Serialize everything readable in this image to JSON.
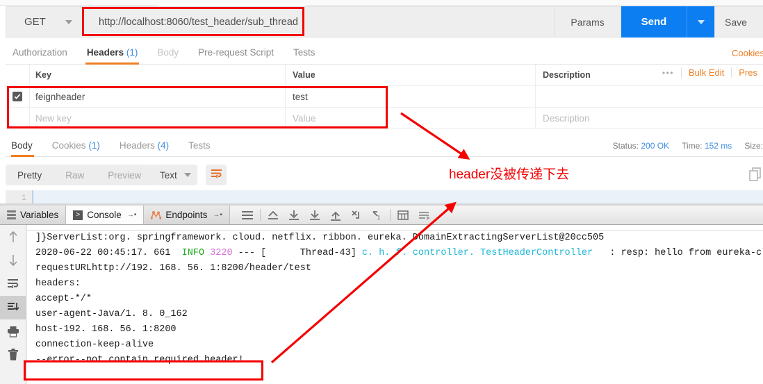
{
  "request": {
    "method": "GET",
    "url": "http://localhost:8060/test_header/sub_thread",
    "params_label": "Params",
    "send_label": "Send",
    "save_label": "Save"
  },
  "request_tabs": [
    {
      "label": "Authorization",
      "count": "",
      "state": "normal"
    },
    {
      "label": "Headers",
      "count": "(1)",
      "state": "active"
    },
    {
      "label": "Body",
      "count": "",
      "state": "dim"
    },
    {
      "label": "Pre-request Script",
      "count": "",
      "state": "normal"
    },
    {
      "label": "Tests",
      "count": "",
      "state": "normal"
    }
  ],
  "cookies_link": "Cookies",
  "headers_table": {
    "columns": [
      "Key",
      "Value",
      "Description"
    ],
    "rows": [
      {
        "checked": true,
        "key": "feignheader",
        "value": "test",
        "description": ""
      }
    ],
    "new_row": {
      "key_placeholder": "New key",
      "value_placeholder": "Value",
      "desc_placeholder": "Description"
    },
    "actions": {
      "dots": "•••",
      "bulk_edit": "Bulk Edit",
      "presets": "Pres"
    }
  },
  "response_tabs": [
    {
      "label": "Body",
      "count": "",
      "state": "active"
    },
    {
      "label": "Cookies",
      "count": "(1)",
      "state": "normal"
    },
    {
      "label": "Headers",
      "count": "(4)",
      "state": "normal"
    },
    {
      "label": "Tests",
      "count": "",
      "state": "normal"
    }
  ],
  "response_meta": {
    "status_label": "Status:",
    "status_value": "200 OK",
    "time_label": "Time:",
    "time_value": "152 ms",
    "size_label": "Size:"
  },
  "body_toolbar": {
    "views": [
      "Pretty",
      "Raw",
      "Preview"
    ],
    "active_view": "Pretty",
    "format": "Text",
    "line_number": "1"
  },
  "ide": {
    "tabs": [
      {
        "label": "Variables",
        "icon": "lines-icon",
        "active": false,
        "pin": ""
      },
      {
        "label": "Console",
        "icon": "console-icon",
        "active": true,
        "pin": "→▪"
      },
      {
        "label": "Endpoints",
        "icon": "endpoints-icon",
        "active": false,
        "pin": "→▪"
      }
    ],
    "toolbar_icons": [
      "menu-icon",
      "step-out-icon",
      "step-over-icon",
      "step-into-icon",
      "force-step-into-icon",
      "run-to-cursor-icon",
      "evaluate-icon",
      "table-icon",
      "settings-icon"
    ],
    "left_icons": [
      "scroll-up-icon",
      "scroll-down-icon",
      "soft-wrap-icon",
      "scroll-to-end-icon",
      "print-icon",
      "trash-icon"
    ],
    "console_lines": [
      {
        "segments": [
          {
            "t": "]}ServerList:org. springframework. cloud. netflix. ribbon. eureka. DomainExtractingServerList@20cc505",
            "c": "plain"
          }
        ]
      },
      {
        "segments": [
          {
            "t": "2020-06-22 00:45:17. 661  ",
            "c": "plain"
          },
          {
            "t": "INFO",
            "c": "green"
          },
          {
            "t": " ",
            "c": "plain"
          },
          {
            "t": "3220",
            "c": "pink"
          },
          {
            "t": " --- [      Thread-43] ",
            "c": "plain"
          },
          {
            "t": "c. h. f. controller. TestHeaderController",
            "c": "cyan"
          },
          {
            "t": "   : resp: hello from eureka-client",
            "c": "plain"
          }
        ]
      },
      {
        "segments": [
          {
            "t": "requestURLhttp://192. 168. 56. 1:8200/header/test",
            "c": "plain"
          }
        ]
      },
      {
        "segments": [
          {
            "t": "headers:",
            "c": "plain"
          }
        ]
      },
      {
        "segments": [
          {
            "t": "accept-*/*",
            "c": "plain"
          }
        ]
      },
      {
        "segments": [
          {
            "t": "user-agent-Java/1. 8. 0_162",
            "c": "plain"
          }
        ]
      },
      {
        "segments": [
          {
            "t": "host-192. 168. 56. 1:8200",
            "c": "plain"
          }
        ]
      },
      {
        "segments": [
          {
            "t": "connection-keep-alive",
            "c": "plain"
          }
        ]
      },
      {
        "segments": [
          {
            "t": "--error--not contain required header!",
            "c": "plain"
          }
        ]
      }
    ]
  },
  "annotations": {
    "note_text": "header没被传递下去",
    "color": "#f40000"
  }
}
